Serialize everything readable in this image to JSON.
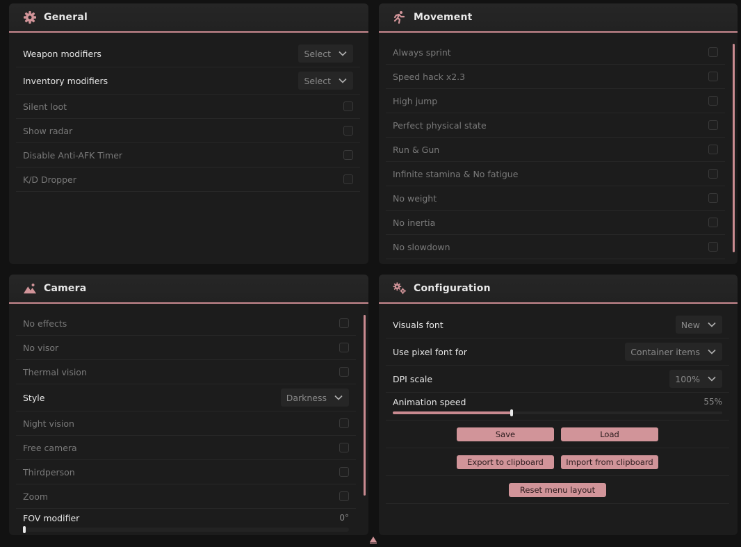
{
  "accent": "#c98a90",
  "general": {
    "title": "General",
    "icon": "gear-icon",
    "selects": [
      {
        "label": "Weapon modifiers",
        "value": "Select"
      },
      {
        "label": "Inventory modifiers",
        "value": "Select"
      }
    ],
    "checks": [
      "Silent loot",
      "Show radar",
      "Disable Anti-AFK Timer",
      "K/D Dropper"
    ]
  },
  "movement": {
    "title": "Movement",
    "icon": "running-person-icon",
    "checks": [
      "Always sprint",
      "Speed hack x2.3",
      "High jump",
      "Perfect physical state",
      "Run & Gun",
      "Infinite stamina & No fatigue",
      "No weight",
      "No inertia",
      "No slowdown"
    ]
  },
  "camera": {
    "title": "Camera",
    "icon": "mountain-image-icon",
    "checks_a": [
      "No effects",
      "No visor",
      "Thermal vision"
    ],
    "style": {
      "label": "Style",
      "value": "Darkness"
    },
    "checks_b": [
      "Night vision",
      "Free camera",
      "Thirdperson",
      "Zoom"
    ],
    "fov": {
      "label": "FOV modifier",
      "value": "0°",
      "fraction": 0
    }
  },
  "configuration": {
    "title": "Configuration",
    "icon": "gears-icon",
    "selects": [
      {
        "label": "Visuals font",
        "value": "New"
      },
      {
        "label": "Use pixel font for",
        "value": "Container items"
      },
      {
        "label": "DPI scale",
        "value": "100%"
      }
    ],
    "animation": {
      "label": "Animation speed",
      "value": "55%",
      "fraction": 0.36
    },
    "buttons": {
      "save": "Save",
      "load": "Load",
      "export": "Export to clipboard",
      "import": "Import from clipboard",
      "reset": "Reset menu layout"
    }
  }
}
